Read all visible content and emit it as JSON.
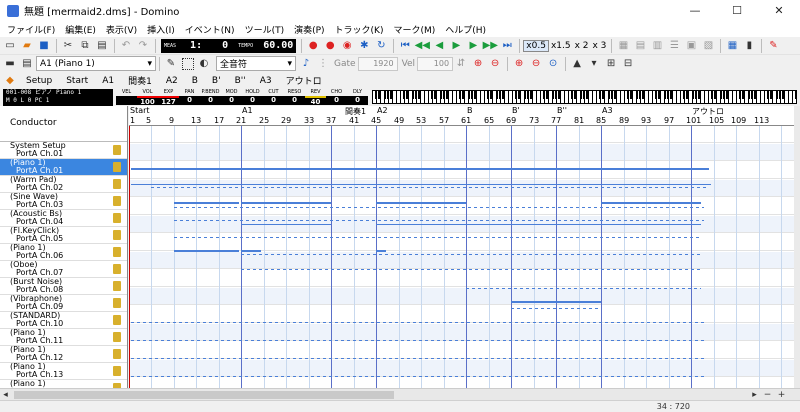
{
  "window": {
    "title": "無題 [mermaid2.dms] - Domino",
    "minimize": "—",
    "maximize": "☐",
    "close": "✕"
  },
  "menu": [
    "ファイル(F)",
    "編集(E)",
    "表示(V)",
    "挿入(I)",
    "イベント(N)",
    "ツール(T)",
    "演奏(P)",
    "トラック(K)",
    "マーク(M)",
    "ヘルプ(H)"
  ],
  "toolbar": {
    "meas_label": "MEAS",
    "meas_value": "1:",
    "tick_value": "0",
    "tempo_label": "TEMPO",
    "tempo_value": "60.00",
    "speed_x05": "x0.5",
    "speed_x15": "x1.5",
    "speed_x2": "x 2",
    "speed_x3": "x 3"
  },
  "toolbar2": {
    "track_select": "A1 (Piano 1)",
    "note_length": "全音符",
    "gate_label": "Gate",
    "gate_value": "1920",
    "vel_label": "Vel",
    "vel_value": "100"
  },
  "marks": [
    "Setup",
    "Start",
    "A1",
    "間奏1",
    "A2",
    "B",
    "B'",
    "B''",
    "A3",
    "アウトロ"
  ],
  "info": {
    "line1": "001-008 ピアノ Piano 1",
    "line2": "M   0  L    0  PC   1",
    "cc": [
      {
        "label": "VEL",
        "value": ""
      },
      {
        "label": "VOL",
        "value": "100"
      },
      {
        "label": "EXP",
        "value": "127"
      },
      {
        "label": "PAN",
        "value": "0"
      },
      {
        "label": "P.BEND",
        "value": "0"
      },
      {
        "label": "MOD",
        "value": "0"
      },
      {
        "label": "HOLD",
        "value": "0"
      },
      {
        "label": "CUT",
        "value": "0"
      },
      {
        "label": "RESO",
        "value": "0"
      },
      {
        "label": "REV",
        "value": "40"
      },
      {
        "label": "CHO",
        "value": "0"
      },
      {
        "label": "DLY",
        "value": "0"
      }
    ]
  },
  "tracks": {
    "conductor": "Conductor",
    "rows": [
      {
        "name": "System Setup",
        "port": "PortA  Ch.01"
      },
      {
        "name": "(Piano 1)",
        "port": "PortA  Ch.01"
      },
      {
        "name": "(Warm Pad)",
        "port": "PortA  Ch.02"
      },
      {
        "name": "(Sine Wave)",
        "port": "PortA  Ch.03"
      },
      {
        "name": "(Acoustic Bs)",
        "port": "PortA  Ch.04"
      },
      {
        "name": "(Fl.KeyClick)",
        "port": "PortA  Ch.05"
      },
      {
        "name": "(Piano 1)",
        "port": "PortA  Ch.06"
      },
      {
        "name": "(Oboe)",
        "port": "PortA  Ch.07"
      },
      {
        "name": "(Burst Noise)",
        "port": "PortA  Ch.08"
      },
      {
        "name": "(Vibraphone)",
        "port": "PortA  Ch.09"
      },
      {
        "name": "(STANDARD)",
        "port": "PortA  Ch.10"
      },
      {
        "name": "(Piano 1)",
        "port": "PortA  Ch.11"
      },
      {
        "name": "(Piano 1)",
        "port": "PortA  Ch.12"
      },
      {
        "name": "(Piano 1)",
        "port": "PortA  Ch.13"
      },
      {
        "name": "(Piano 1)",
        "port": ""
      }
    ]
  },
  "ruler": {
    "measures": [
      "1",
      "5",
      "9",
      "13",
      "17",
      "21",
      "25",
      "29",
      "33",
      "37",
      "41",
      "45",
      "49",
      "53",
      "57",
      "61",
      "65",
      "69",
      "73",
      "77",
      "81",
      "85",
      "89",
      "93",
      "97",
      "101",
      "105",
      "109",
      "113"
    ],
    "marks": [
      "Start",
      "A1",
      "間奏1",
      "A2",
      "B",
      "B'",
      "B''",
      "A3",
      "アウトロ"
    ]
  },
  "status": {
    "position": "34 : 720"
  }
}
